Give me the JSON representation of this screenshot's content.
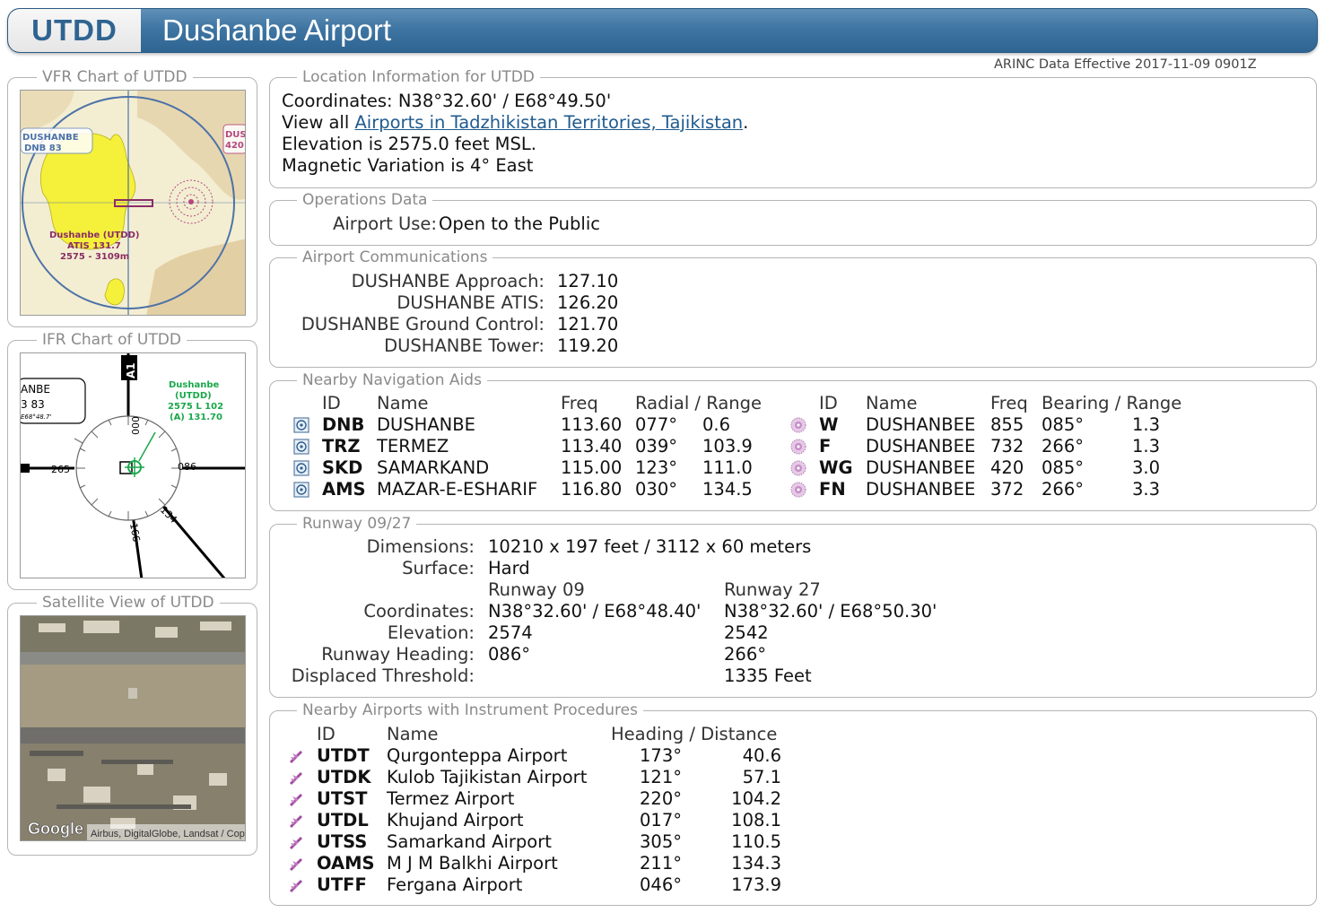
{
  "header": {
    "id": "UTDD",
    "title": "Dushanbe Airport"
  },
  "arinc": "ARINC Data Effective 2017-11-09 0901Z",
  "vfr": {
    "legend": "VFR Chart of UTDD",
    "labels": [
      "DUSHANBE",
      "DNB 83",
      "DUS",
      "420",
      "Dushanbe (UTDD)",
      "ATIS 131.7",
      "2575 - 3109m"
    ]
  },
  "ifr": {
    "legend": "IFR Chart of UTDD",
    "labels": [
      "Dushanbe",
      "(UTDD)",
      "2575 L 102",
      "(A) 131.70",
      "ANBE",
      "3 83",
      "E68°48.7'",
      "265",
      "086",
      "000",
      "134",
      "166",
      "A1"
    ]
  },
  "sat": {
    "legend": "Satellite View of UTDD",
    "logo": "Google",
    "credit": "Airbus, DigitalGlobe, Landsat / Copernicus"
  },
  "location": {
    "legend": "Location Information for UTDD",
    "coords_prefix": "Coordinates: ",
    "coords": "N38°32.60' / E68°49.50'",
    "view_prefix": "View all ",
    "view_link": "Airports in Tadzhikistan Territories, Tajikistan",
    "view_suffix": ".",
    "elevation": "Elevation is 2575.0 feet MSL.",
    "magvar": "Magnetic Variation is 4° East"
  },
  "operations": {
    "legend": "Operations Data",
    "label": "Airport Use:",
    "value": "Open to the Public"
  },
  "comms": {
    "legend": "Airport Communications",
    "items": [
      {
        "label": "DUSHANBE Approach:",
        "value": "127.10"
      },
      {
        "label": "DUSHANBE ATIS:",
        "value": "126.20"
      },
      {
        "label": "DUSHANBE Ground Control:",
        "value": "121.70"
      },
      {
        "label": "DUSHANBE Tower:",
        "value": "119.20"
      }
    ]
  },
  "navaids": {
    "legend": "Nearby Navigation Aids",
    "vor_headers": {
      "id": "ID",
      "name": "Name",
      "freq": "Freq",
      "rr": "Radial / Range"
    },
    "ndb_headers": {
      "id": "ID",
      "name": "Name",
      "freq": "Freq",
      "br": "Bearing / Range"
    },
    "vor": [
      {
        "id": "DNB",
        "name": "DUSHANBE",
        "freq": "113.60",
        "radial": "077°",
        "range": "0.6"
      },
      {
        "id": "TRZ",
        "name": "TERMEZ",
        "freq": "113.40",
        "radial": "039°",
        "range": "103.9"
      },
      {
        "id": "SKD",
        "name": "SAMARKAND",
        "freq": "115.00",
        "radial": "123°",
        "range": "111.0"
      },
      {
        "id": "AMS",
        "name": "MAZAR-E-ESHARIF",
        "freq": "116.80",
        "radial": "030°",
        "range": "134.5"
      }
    ],
    "ndb": [
      {
        "id": "W",
        "name": "DUSHANBEE",
        "freq": "855",
        "bearing": "085°",
        "range": "1.3"
      },
      {
        "id": "F",
        "name": "DUSHANBEE",
        "freq": "732",
        "bearing": "266°",
        "range": "1.3"
      },
      {
        "id": "WG",
        "name": "DUSHANBEE",
        "freq": "420",
        "bearing": "085°",
        "range": "3.0"
      },
      {
        "id": "FN",
        "name": "DUSHANBEE",
        "freq": "372",
        "bearing": "266°",
        "range": "3.3"
      }
    ]
  },
  "runway": {
    "legend": "Runway 09/27",
    "dimensions_label": "Dimensions:",
    "dimensions": "10210 x 197 feet / 3112 x 60 meters",
    "surface_label": "Surface:",
    "surface": "Hard",
    "end1": "Runway 09",
    "end2": "Runway 27",
    "coords_label": "Coordinates:",
    "coords1": "N38°32.60' / E68°48.40'",
    "coords2": "N38°32.60' / E68°50.30'",
    "elev_label": "Elevation:",
    "elev1": "2574",
    "elev2": "2542",
    "heading_label": "Runway Heading:",
    "heading1": "086°",
    "heading2": "266°",
    "disp_label": "Displaced Threshold:",
    "disp1": "",
    "disp2": "1335 Feet"
  },
  "nearby": {
    "legend": "Nearby Airports with Instrument Procedures",
    "headers": {
      "id": "ID",
      "name": "Name",
      "hd": "Heading / Distance"
    },
    "items": [
      {
        "id": "UTDT",
        "name": "Qurgonteppa Airport",
        "heading": "173°",
        "distance": "40.6"
      },
      {
        "id": "UTDK",
        "name": "Kulob Tajikistan Airport",
        "heading": "121°",
        "distance": "57.1"
      },
      {
        "id": "UTST",
        "name": "Termez Airport",
        "heading": "220°",
        "distance": "104.2"
      },
      {
        "id": "UTDL",
        "name": "Khujand Airport",
        "heading": "017°",
        "distance": "108.1"
      },
      {
        "id": "UTSS",
        "name": "Samarkand Airport",
        "heading": "305°",
        "distance": "110.5"
      },
      {
        "id": "OAMS",
        "name": "M J M Balkhi Airport",
        "heading": "211°",
        "distance": "134.3"
      },
      {
        "id": "UTFF",
        "name": "Fergana Airport",
        "heading": "046°",
        "distance": "173.9"
      }
    ]
  }
}
